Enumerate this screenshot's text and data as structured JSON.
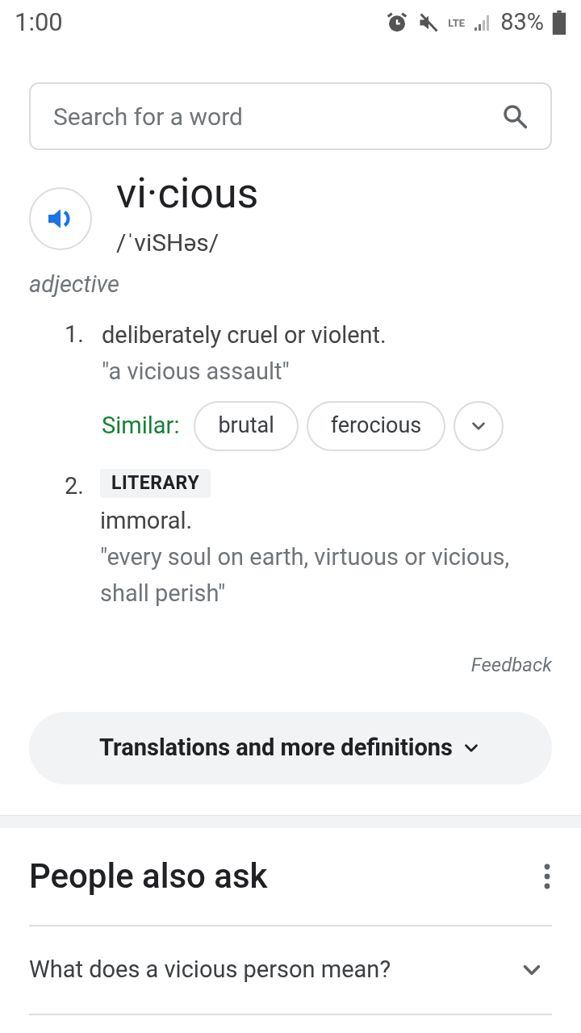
{
  "status_bar": {
    "time": "1:00",
    "network": "LTE",
    "battery": "83%"
  },
  "search": {
    "placeholder": "Search for a word"
  },
  "entry": {
    "word": "vi·cious",
    "phonetic": "/ˈviSHəs/",
    "part_of_speech": "adjective",
    "senses": [
      {
        "number": "1.",
        "definition": "deliberately cruel or violent.",
        "example": "\"a vicious assault\"",
        "similar_label": "Similar:",
        "similar": [
          "brutal",
          "ferocious"
        ]
      },
      {
        "number": "2.",
        "register": "LITERARY",
        "definition": "immoral.",
        "example": "\"every soul on earth, virtuous or vicious, shall perish\""
      }
    ]
  },
  "feedback": "Feedback",
  "more_button": "Translations and more definitions",
  "people_also_ask": {
    "title": "People also ask",
    "questions": [
      {
        "text": "What does a vicious person mean?",
        "expanded": false
      }
    ]
  }
}
